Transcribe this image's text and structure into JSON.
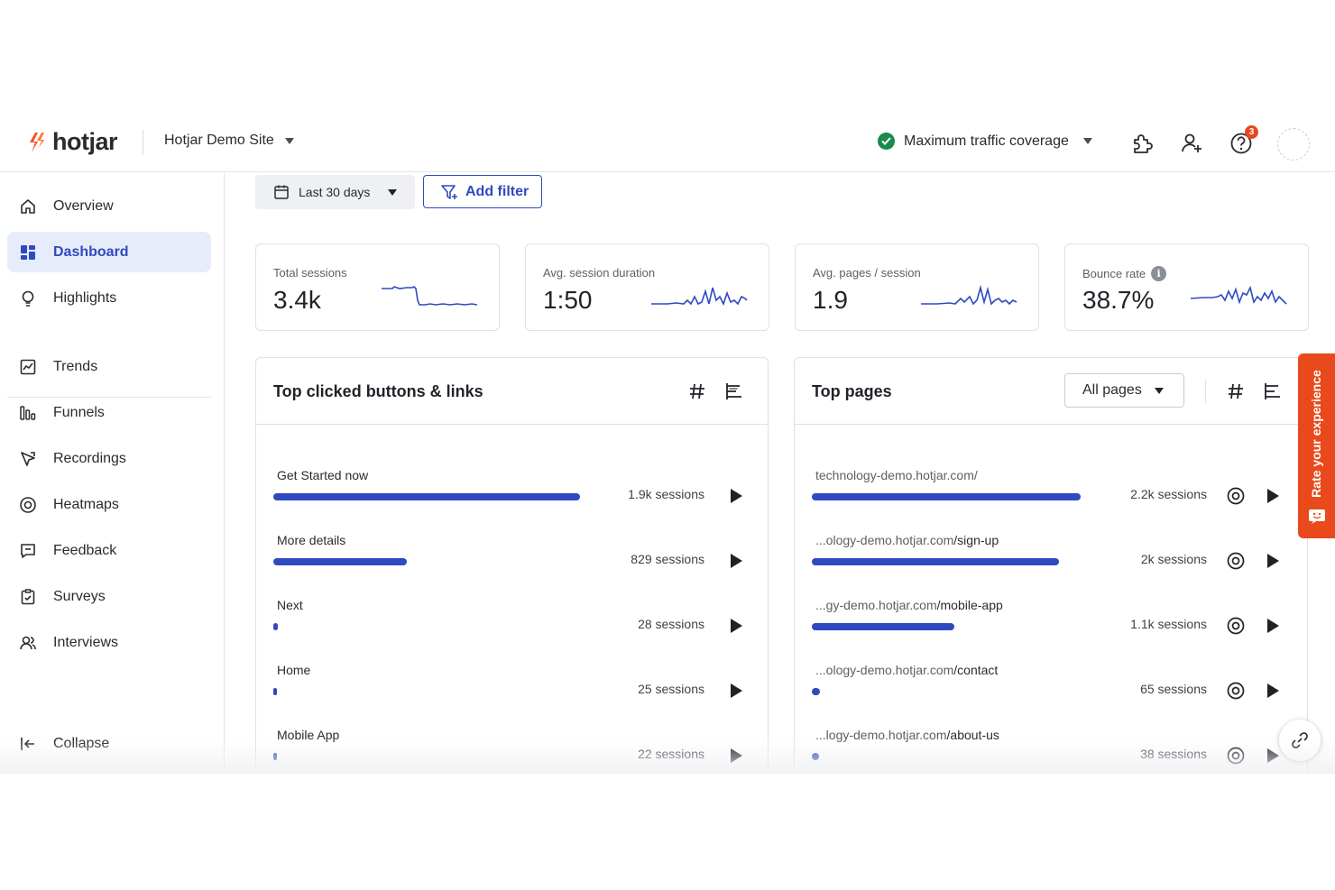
{
  "topbar": {
    "brand": "hotjar",
    "site": "Hotjar Demo Site",
    "coverage": "Maximum traffic coverage",
    "help_badge": "3"
  },
  "sidebar": {
    "items": [
      {
        "label": "Overview",
        "icon": "home-icon"
      },
      {
        "label": "Dashboard",
        "icon": "dashboard-icon",
        "active": true
      },
      {
        "label": "Highlights",
        "icon": "lightbulb-icon"
      },
      {
        "label": "Trends",
        "icon": "trends-icon"
      },
      {
        "label": "Funnels",
        "icon": "funnels-icon"
      },
      {
        "label": "Recordings",
        "icon": "recordings-icon"
      },
      {
        "label": "Heatmaps",
        "icon": "heatmaps-icon"
      },
      {
        "label": "Feedback",
        "icon": "feedback-icon"
      },
      {
        "label": "Surveys",
        "icon": "surveys-icon"
      },
      {
        "label": "Interviews",
        "icon": "interviews-icon"
      }
    ],
    "collapse": "Collapse"
  },
  "toolbar": {
    "date_range": "Last 30 days",
    "add_filter": "Add filter"
  },
  "metrics": [
    {
      "label": "Total sessions",
      "value": "3.4k"
    },
    {
      "label": "Avg. session duration",
      "value": "1:50"
    },
    {
      "label": "Avg. pages / session",
      "value": "1.9"
    },
    {
      "label": "Bounce rate",
      "value": "38.7%",
      "info": "i"
    }
  ],
  "top_clicked": {
    "title": "Top clicked buttons & links",
    "rows": [
      {
        "label": "Get Started now",
        "sessions": "1.9k sessions",
        "share": 1.0
      },
      {
        "label": "More details",
        "sessions": "829 sessions",
        "share": 0.436
      },
      {
        "label": "Next",
        "sessions": "28 sessions",
        "share": 0.015
      },
      {
        "label": "Home",
        "sessions": "25 sessions",
        "share": 0.013
      },
      {
        "label": "Mobile App",
        "sessions": "22 sessions",
        "share": 0.012
      }
    ]
  },
  "top_pages": {
    "title": "Top pages",
    "filter": "All pages",
    "rows": [
      {
        "prefix": "technology-demo.hotjar.com/",
        "path": "",
        "sessions": "2.2k sessions",
        "share": 1.0
      },
      {
        "prefix": "...ology-demo.hotjar.com",
        "path": "/sign-up",
        "sessions": "2k sessions",
        "share": 0.92
      },
      {
        "prefix": "...gy-demo.hotjar.com",
        "path": "/mobile-app",
        "sessions": "1.1k sessions",
        "share": 0.53
      },
      {
        "prefix": "...ology-demo.hotjar.com",
        "path": "/contact",
        "sessions": "65 sessions",
        "share": 0.03
      },
      {
        "prefix": "...logy-demo.hotjar.com",
        "path": "/about-us",
        "sessions": "38 sessions",
        "share": 0.018
      }
    ]
  },
  "feedback_tab": "Rate your experience",
  "colors": {
    "accent": "#2f4ac0",
    "brand": "#e84a1c",
    "success": "#1a8a4c"
  }
}
